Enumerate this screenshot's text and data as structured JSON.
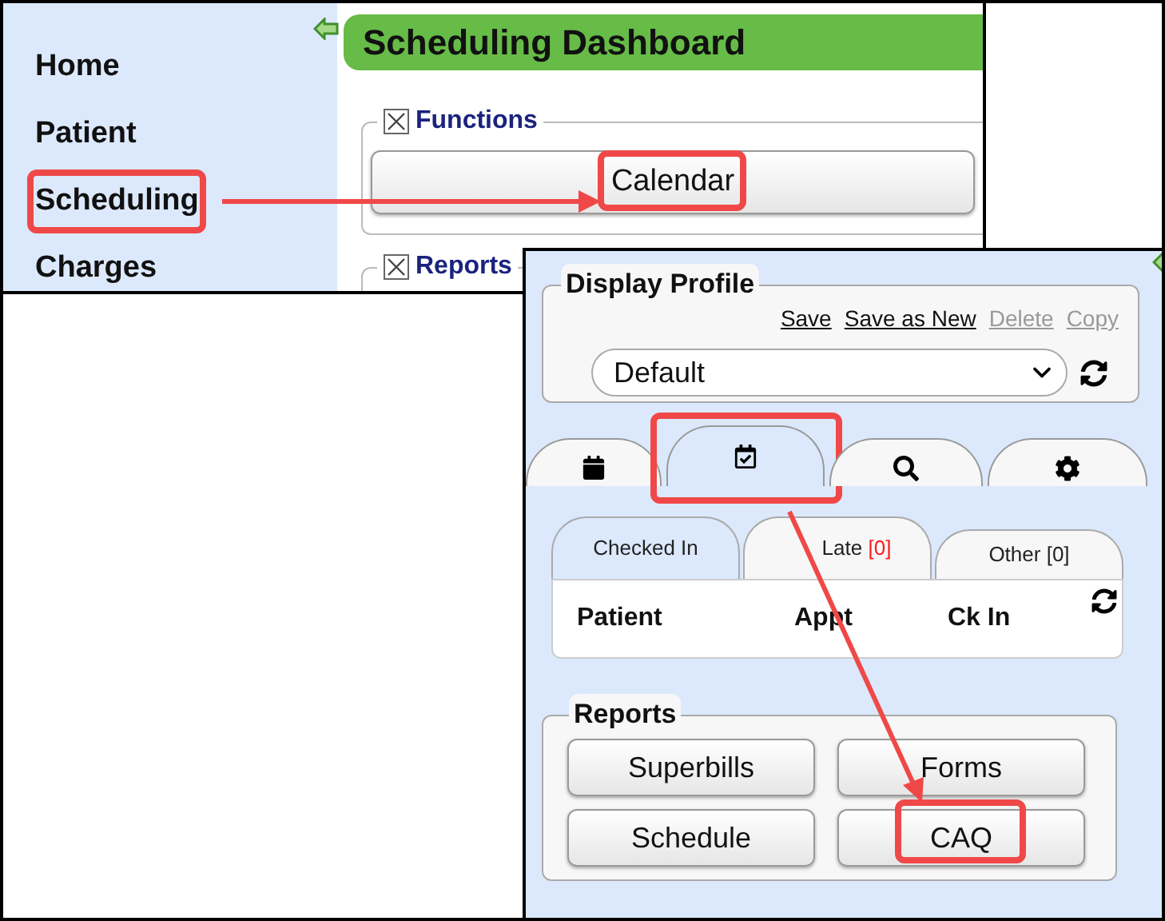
{
  "dashboard": {
    "title": "Scheduling Dashboard",
    "sidebar": {
      "items": [
        {
          "label": "Home",
          "highlighted": false
        },
        {
          "label": "Patient",
          "highlighted": false
        },
        {
          "label": "Scheduling",
          "highlighted": true
        },
        {
          "label": "Charges",
          "highlighted": false
        }
      ]
    },
    "sections": [
      {
        "title": "Functions",
        "buttons": [
          {
            "label": "Calendar",
            "highlighted": true
          }
        ]
      },
      {
        "title": "Reports"
      }
    ]
  },
  "panel": {
    "profile": {
      "legend": "Display Profile",
      "links": [
        {
          "label": "Save",
          "disabled": false
        },
        {
          "label": "Save as New",
          "disabled": false
        },
        {
          "label": "Delete",
          "disabled": true
        },
        {
          "label": "Copy",
          "disabled": true
        }
      ],
      "select": {
        "value": "Default"
      }
    },
    "tabs": [
      {
        "kind": "calendar",
        "selected": false,
        "highlighted": false
      },
      {
        "kind": "calendar-check",
        "selected": true,
        "highlighted": true
      },
      {
        "kind": "search",
        "selected": false,
        "highlighted": false
      },
      {
        "kind": "settings",
        "selected": false,
        "highlighted": false
      }
    ],
    "subtabs": [
      {
        "label": "Checked In",
        "selected": true
      },
      {
        "label": "Late",
        "count": "[0]",
        "alert": true,
        "selected": false
      },
      {
        "label": "Other",
        "count": "[0]",
        "alert": false,
        "selected": false
      }
    ],
    "table": {
      "columns": [
        "Patient",
        "Appt",
        "Ck In"
      ]
    },
    "reports": {
      "legend": "Reports",
      "buttons": [
        {
          "label": "Superbills",
          "highlighted": false
        },
        {
          "label": "Forms",
          "highlighted": false
        },
        {
          "label": "Schedule",
          "highlighted": false
        },
        {
          "label": "CAQ",
          "highlighted": true
        }
      ]
    }
  }
}
